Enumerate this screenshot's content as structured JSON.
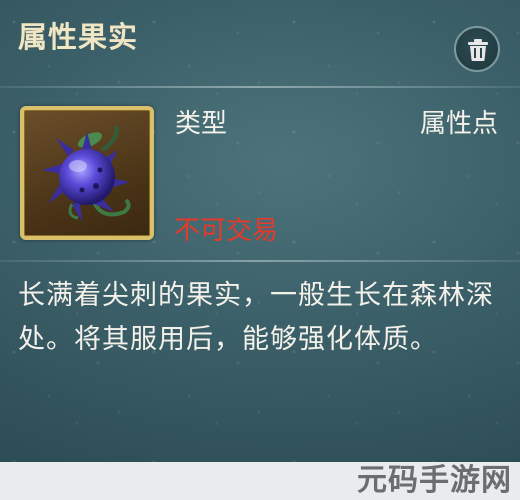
{
  "panel": {
    "title": "属性果实",
    "delete_icon": "trash-icon"
  },
  "item": {
    "icon": "spiked-berry-icon",
    "type_label": "类型",
    "type_value": "属性点",
    "trade_status": "不可交易",
    "description": "长满着尖刺的果实，一般生长在森林深处。将其服用后，能够强化体质。"
  },
  "colors": {
    "title": "#f1e6c3",
    "text": "#f4f1ea",
    "untradeable": "#e8382a",
    "frame_gold": "#d9c06a",
    "panel_bg": "#3b5f68"
  },
  "watermark": {
    "text": "元码手游网"
  }
}
